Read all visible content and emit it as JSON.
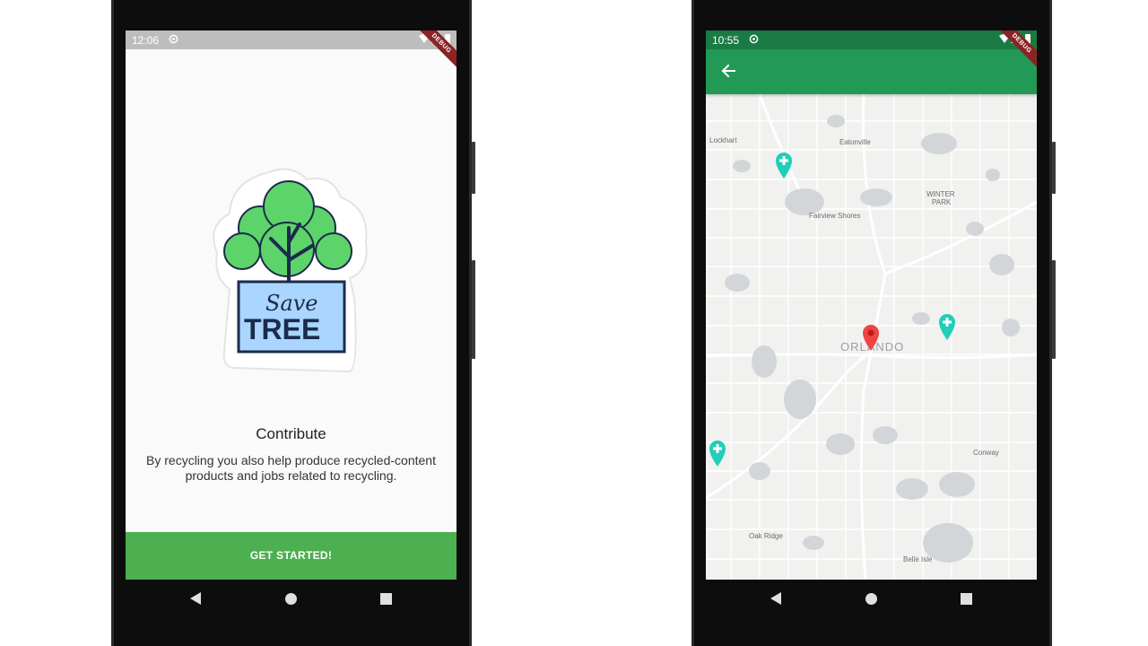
{
  "left_phone": {
    "status": {
      "time": "12:06",
      "debug_label": "DEBUG"
    },
    "illustration": {
      "line1": "Save",
      "line2": "TREE"
    },
    "title": "Contribute",
    "description": "By recycling you also help produce recycled-content products and jobs related to recycling.",
    "button_label": "GET STARTED!"
  },
  "right_phone": {
    "status": {
      "time": "10:55",
      "debug_label": "DEBUG"
    },
    "map": {
      "city": "ORLANDO",
      "places": [
        "Lockhart",
        "Eatonville",
        "WINTER",
        "PARK",
        "Fairview Shores",
        "Conway",
        "Oak Ridge",
        "Belle Isle"
      ],
      "markers": [
        {
          "name": "teal-plus-marker",
          "color": "#1fcfb8"
        },
        {
          "name": "teal-plus-marker",
          "color": "#1fcfb8"
        },
        {
          "name": "teal-plus-marker",
          "color": "#1fcfb8"
        },
        {
          "name": "current-location-marker",
          "color": "#ef4444"
        }
      ]
    }
  },
  "colors": {
    "primary_green": "#4caf50",
    "appbar_green": "#229955",
    "statusbar_green": "#1a7a44",
    "statusbar_gray": "#bdbdbd",
    "marker_teal": "#1fcfb8",
    "marker_red": "#ef4444"
  }
}
